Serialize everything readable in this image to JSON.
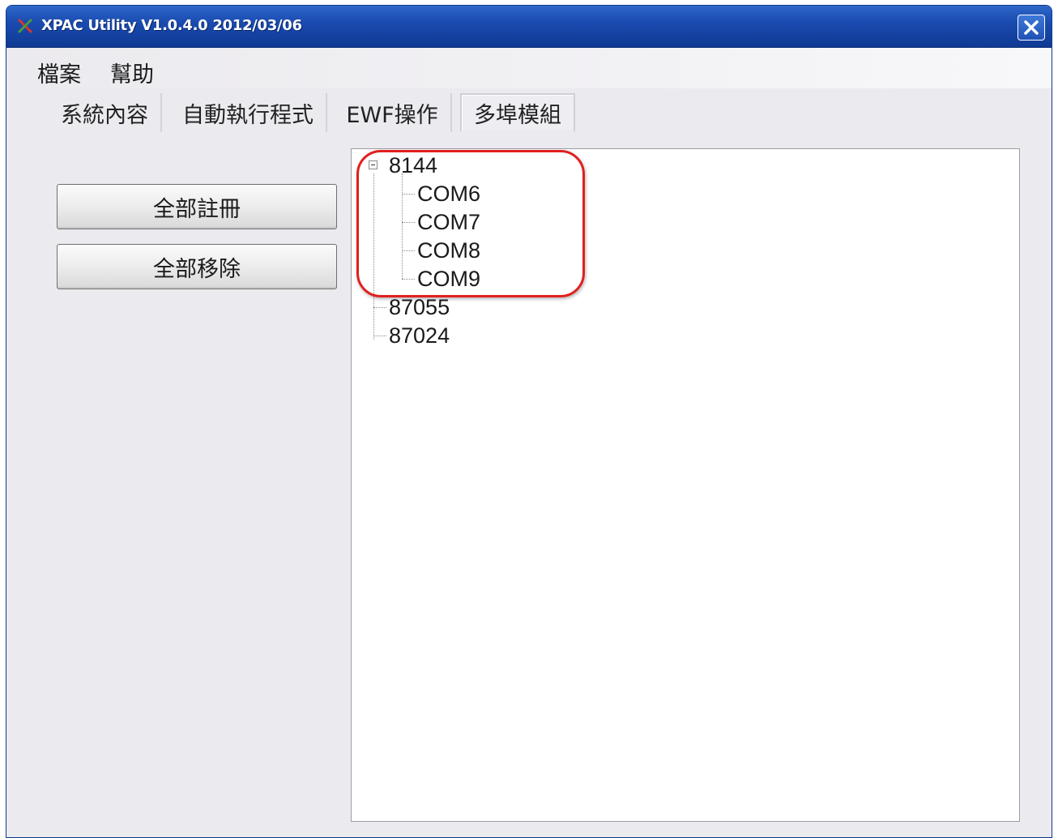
{
  "window": {
    "title": "XPAC Utility V1.0.4.0  2012/03/06",
    "icon": "x-app-icon",
    "close_icon": "close-icon"
  },
  "menu": {
    "items": [
      {
        "label": "檔案"
      },
      {
        "label": "幫助"
      }
    ]
  },
  "tabs": [
    {
      "label": "系統內容",
      "active": false
    },
    {
      "label": "自動執行程式",
      "active": false
    },
    {
      "label": "EWF操作",
      "active": false
    },
    {
      "label": "多埠模組",
      "active": true
    }
  ],
  "actions": {
    "register_all": "全部註冊",
    "remove_all": "全部移除"
  },
  "tree": {
    "root": {
      "label": "8144",
      "expanded": true,
      "children": [
        "COM6",
        "COM7",
        "COM8",
        "COM9"
      ]
    },
    "siblings": [
      "87055",
      "87024"
    ]
  },
  "colors": {
    "titlebar": "#1a4bb0",
    "highlight": "#e0201e"
  }
}
